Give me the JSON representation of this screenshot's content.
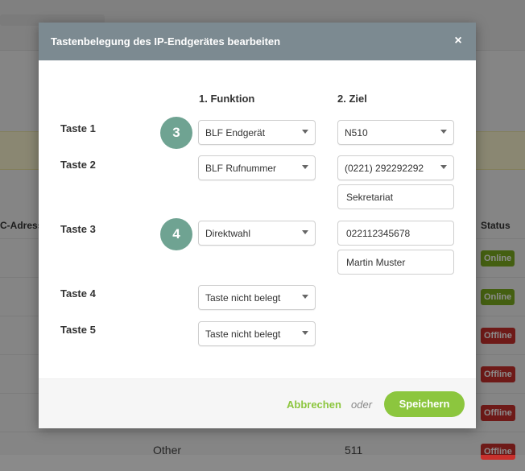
{
  "background": {
    "table": {
      "mac_header": "C-Adresse",
      "status_header": "Status",
      "statuses": [
        "Online",
        "Online",
        "Offline",
        "Offline",
        "Offline",
        "Offline"
      ],
      "last_row": {
        "type": "Other",
        "number": "511"
      }
    }
  },
  "modal": {
    "title": "Tastenbelegung des IP-Endgerätes bearbeiten",
    "close_icon": "×",
    "columns": {
      "function": "1. Funktion",
      "target": "2. Ziel"
    },
    "keys": [
      {
        "label": "Taste 1",
        "function": "BLF Endgerät",
        "target_select": "N510"
      },
      {
        "label": "Taste 2",
        "function": "BLF Rufnummer",
        "target_select": "(0221) 292292292",
        "target_name": "Sekretariat"
      },
      {
        "label": "Taste 3",
        "function": "Direktwahl",
        "target_number": "022112345678",
        "target_name": "Martin Muster"
      },
      {
        "label": "Taste 4",
        "function": "Taste nicht belegt"
      },
      {
        "label": "Taste 5",
        "function": "Taste nicht belegt"
      }
    ],
    "step_badges": [
      "3",
      "4"
    ],
    "footer": {
      "cancel": "Abbrechen",
      "or": "oder",
      "save": "Speichern"
    }
  },
  "colors": {
    "header_bg": "#7c8a91",
    "accent_green": "#8cc63e",
    "badge_teal": "#6fa392",
    "online": "#7dae1f",
    "offline": "#c9302c"
  }
}
